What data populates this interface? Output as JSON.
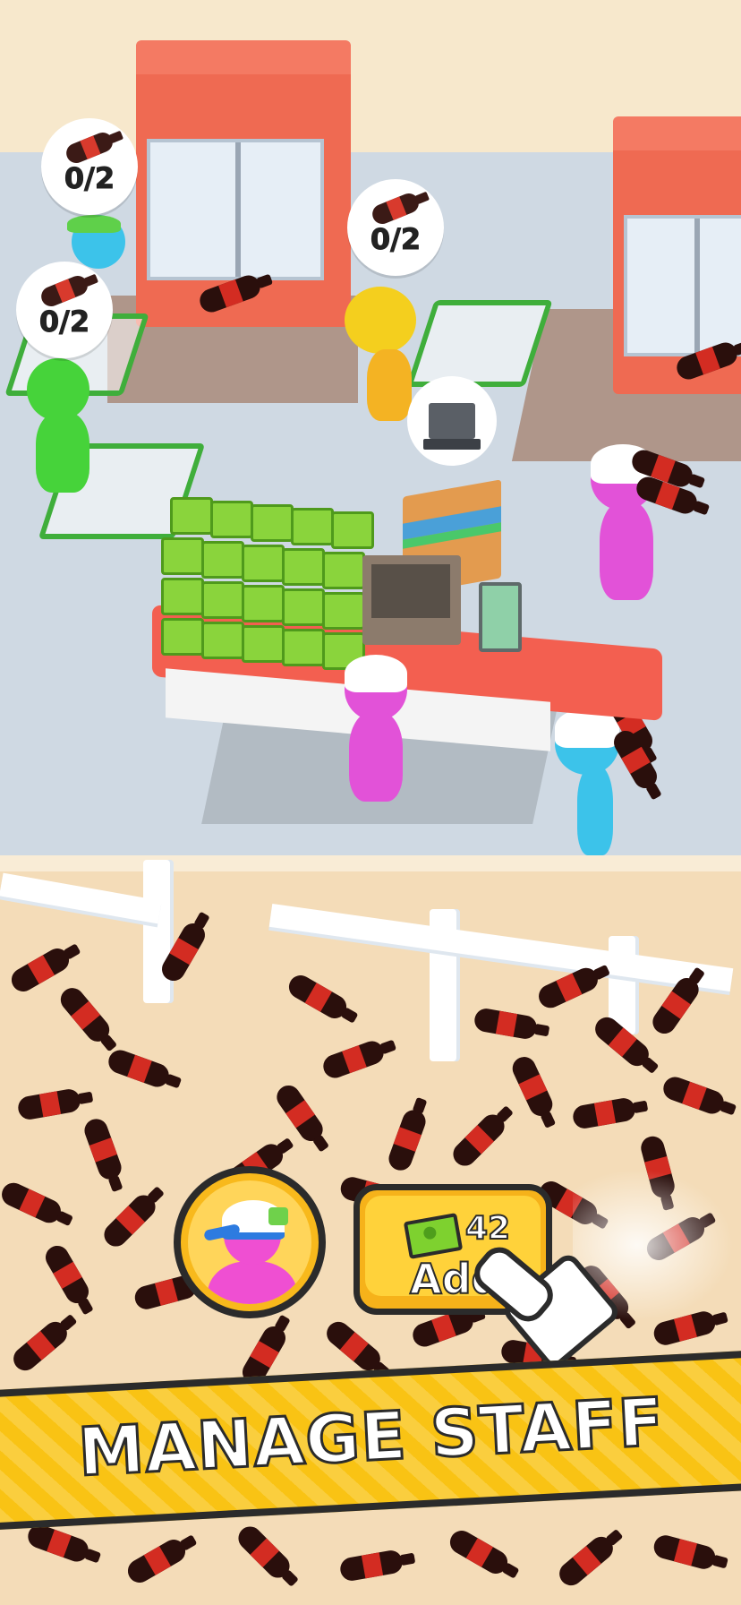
{
  "bubbles": {
    "left_top": {
      "count": "0/2",
      "icon": "cola-bottle-icon"
    },
    "left_mid": {
      "count": "0/2",
      "icon": "cola-bottle-icon"
    },
    "center": {
      "count": "0/2",
      "icon": "cola-bottle-icon"
    },
    "register": {
      "icon": "cash-register-icon"
    }
  },
  "hire_button": {
    "price": "42",
    "label": "Add",
    "icon": "cash-icon"
  },
  "avatar": {
    "icon": "staff-avatar-icon"
  },
  "banner": {
    "text": "MANAGE STAFF"
  },
  "colors": {
    "banner": "#f9c314",
    "button": "#ffd23a",
    "fridge": "#ef6a52",
    "floor": "#cfd9e3",
    "counter": "#f35f50",
    "cola": "#2a0f0c",
    "cola_label": "#d32c22"
  }
}
